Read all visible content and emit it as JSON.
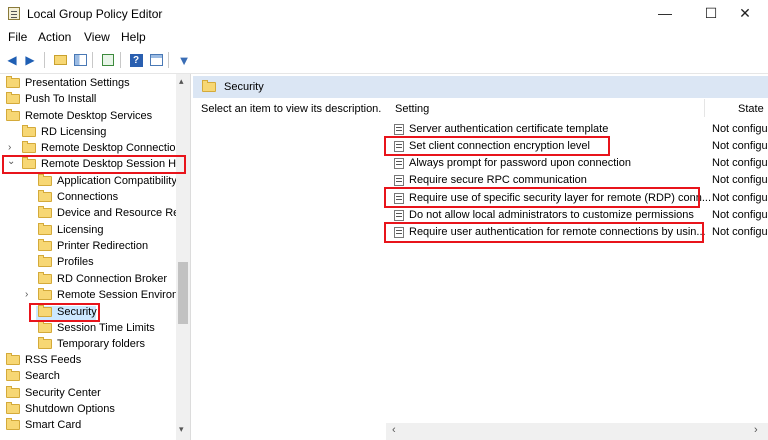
{
  "window": {
    "title": "Local Group Policy Editor",
    "minimize": "—",
    "maximize": "☐",
    "close": "✕"
  },
  "menu": [
    "File",
    "Action",
    "View",
    "Help"
  ],
  "tree": [
    {
      "label": "Presentation Settings"
    },
    {
      "label": "Push To Install"
    },
    {
      "label": "Remote Desktop Services"
    },
    {
      "label": "RD Licensing"
    },
    {
      "label": "Remote Desktop Connection"
    },
    {
      "label": "Remote Desktop Session Ho"
    },
    {
      "label": "Application Compatibility"
    },
    {
      "label": "Connections"
    },
    {
      "label": "Device and Resource Red"
    },
    {
      "label": "Licensing"
    },
    {
      "label": "Printer Redirection"
    },
    {
      "label": "Profiles"
    },
    {
      "label": "RD Connection Broker"
    },
    {
      "label": "Remote Session Environ"
    },
    {
      "label": "Security"
    },
    {
      "label": "Session Time Limits"
    },
    {
      "label": "Temporary folders"
    },
    {
      "label": "RSS Feeds"
    },
    {
      "label": "Search"
    },
    {
      "label": "Security Center"
    },
    {
      "label": "Shutdown Options"
    },
    {
      "label": "Smart Card"
    }
  ],
  "right": {
    "header": "Security",
    "description": "Select an item to view its description.",
    "columns": {
      "setting": "Setting",
      "state": "State"
    },
    "rows": [
      {
        "setting": "Server authentication certificate template",
        "state": "Not configu"
      },
      {
        "setting": "Set client connection encryption level",
        "state": "Not configu"
      },
      {
        "setting": "Always prompt for password upon connection",
        "state": "Not configu"
      },
      {
        "setting": "Require secure RPC communication",
        "state": "Not configu"
      },
      {
        "setting": "Require use of specific security layer for remote (RDP) conn...",
        "state": "Not configu"
      },
      {
        "setting": "Do not allow local administrators to customize permissions",
        "state": "Not configu"
      },
      {
        "setting": "Require user authentication for remote connections by usin...",
        "state": "Not configu"
      }
    ]
  },
  "colors": {
    "highlight": "#e8141b",
    "header_bg": "#dbe6f4",
    "folder": "#f7d774"
  }
}
